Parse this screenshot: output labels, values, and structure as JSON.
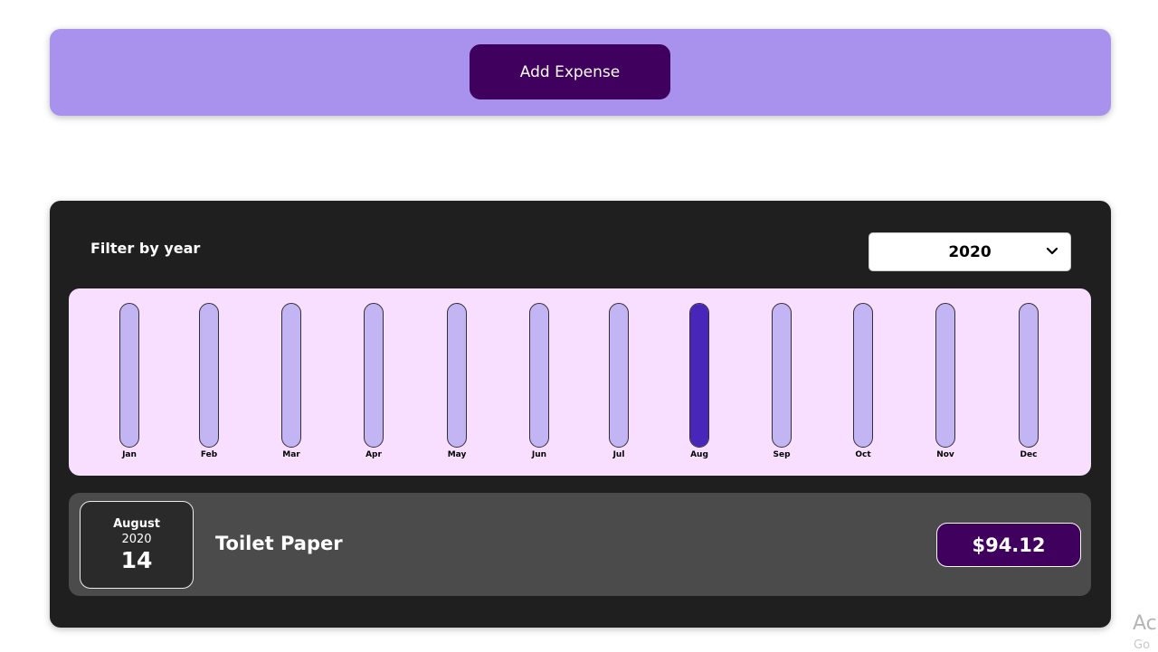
{
  "new_expense": {
    "add_button_label": "Add Expense"
  },
  "filter": {
    "label": "Filter by year",
    "selected_year": "2020"
  },
  "chart_data": {
    "type": "bar",
    "categories": [
      "Jan",
      "Feb",
      "Mar",
      "Apr",
      "May",
      "Jun",
      "Jul",
      "Aug",
      "Sep",
      "Oct",
      "Nov",
      "Dec"
    ],
    "values": [
      0,
      0,
      0,
      0,
      0,
      0,
      0,
      94.12,
      0,
      0,
      0,
      0
    ],
    "max_value": 94.12,
    "colors": {
      "track": "#c3b4f3",
      "fill": "#4826b9",
      "background": "#f8dfff"
    }
  },
  "expenses": [
    {
      "month": "August",
      "year": "2020",
      "day": "14",
      "title": "Toilet Paper",
      "amount": "$94.12"
    }
  ],
  "watermark": {
    "line1": "Ac",
    "line2": "Go"
  },
  "colors": {
    "accent_purple": "#a892ee",
    "dark_purple": "#40005d",
    "card_dark": "#1f1f1f",
    "item_bg": "#4b4b4b"
  }
}
